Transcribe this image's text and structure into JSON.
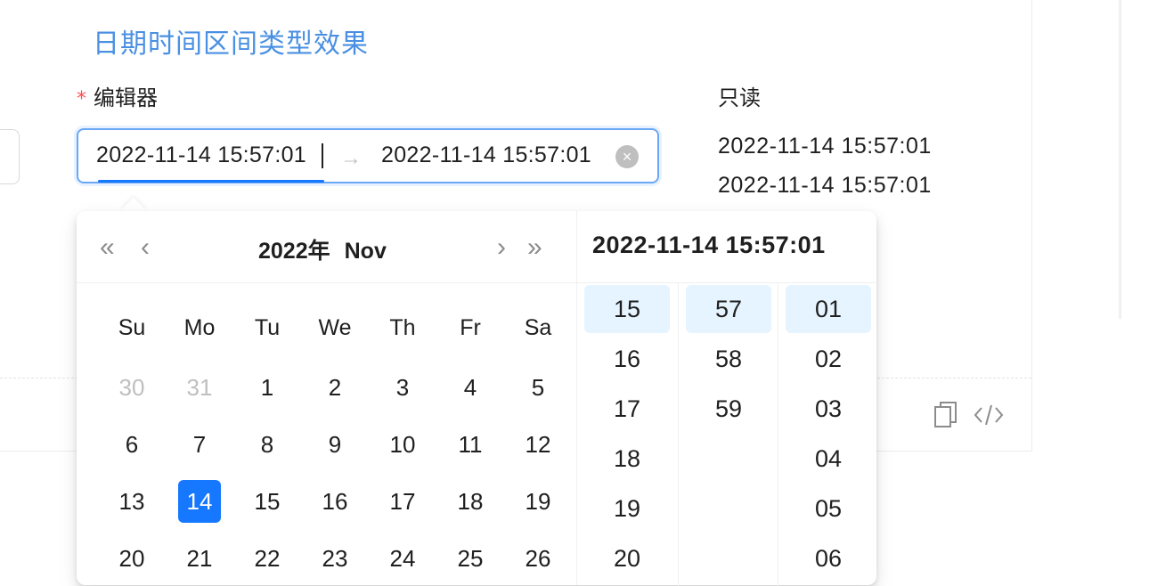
{
  "section_title": "日期时间区间类型效果",
  "form": {
    "editor_label": "编辑器",
    "required_mark": "*",
    "readonly_label": "只读",
    "start_value": "2022-11-14 15:57:01",
    "end_value": "2022-11-14 15:57:01",
    "range_separator": "→",
    "clear_icon": "close-circle-icon",
    "readonly_values": [
      "2022-11-14 15:57:01",
      "2022-11-14 15:57:01"
    ]
  },
  "picker": {
    "nav": {
      "super_prev": "«",
      "prev": "‹",
      "next": "›",
      "super_next": "»"
    },
    "year_label": "2022年",
    "month_label": "Nov",
    "time_header": "2022-11-14 15:57:01",
    "weekdays": [
      "Su",
      "Mo",
      "Tu",
      "We",
      "Th",
      "Fr",
      "Sa"
    ],
    "weeks": [
      [
        "30",
        "31",
        "1",
        "2",
        "3",
        "4",
        "5"
      ],
      [
        "6",
        "7",
        "8",
        "9",
        "10",
        "11",
        "12"
      ],
      [
        "13",
        "14",
        "15",
        "16",
        "17",
        "18",
        "19"
      ],
      [
        "20",
        "21",
        "22",
        "23",
        "24",
        "25",
        "26"
      ]
    ],
    "muted_days": [
      "30",
      "31"
    ],
    "selected_day": "14",
    "hours": [
      "15",
      "16",
      "17",
      "18",
      "19",
      "20"
    ],
    "minutes": [
      "57",
      "58",
      "59"
    ],
    "seconds": [
      "01",
      "02",
      "03",
      "04",
      "05",
      "06"
    ],
    "selected_hour": "15",
    "selected_minute": "57",
    "selected_second": "01"
  },
  "toolbar": {
    "copy_icon": "copy-icon",
    "code_icon": "code-icon"
  },
  "colors": {
    "accent": "#1677ff",
    "title": "#4a90e2",
    "required": "#ff4d4f",
    "selected_time_bg": "#e6f4ff"
  }
}
